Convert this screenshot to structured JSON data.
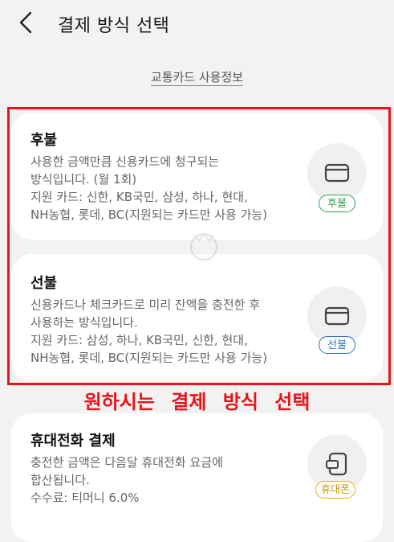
{
  "header": {
    "title": "결제 방식 선택",
    "back_icon": "chevron-left-icon"
  },
  "info_link": "교통카드 사용정보",
  "cards": [
    {
      "title": "후불",
      "desc_line1": "사용한 금액만큼 신용카드에 청구되는",
      "desc_line2": "방식입니다. (월 1회)",
      "support_line1": "지원 카드: 신한, KB국민, 삼성, 하나, 현대,",
      "support_line2": "NH농협, 롯데, BC(지원되는 카드만 사용 가능)",
      "badge": "후불",
      "badge_color": "#2e9e4f",
      "icon": "credit-card-icon"
    },
    {
      "title": "선불",
      "desc_line1": "신용카드나 체크카드로 미리 잔액을 충전한 후",
      "desc_line2": "사용하는 방식입니다.",
      "support_line1": "지원 카드: 삼성, 하나, KB국민, 신한, 현대,",
      "support_line2": "NH농협, 롯데, BC(지원되는 카드만 사용 가능)",
      "badge": "선불",
      "badge_color": "#2f6fb7",
      "icon": "credit-card-icon"
    },
    {
      "title": "휴대전화 결제",
      "desc_line1": "충전한 금액은 다음달 휴대전화 요금에",
      "desc_line2": "합산됩니다.",
      "support_line1": "수수료: 티머니 6.0%",
      "badge": "휴대폰",
      "badge_color": "#e0b400",
      "icon": "phone-card-icon"
    }
  ],
  "annotation": "원하시는 결제 방식 선택",
  "highlight_color": "#e8141b"
}
